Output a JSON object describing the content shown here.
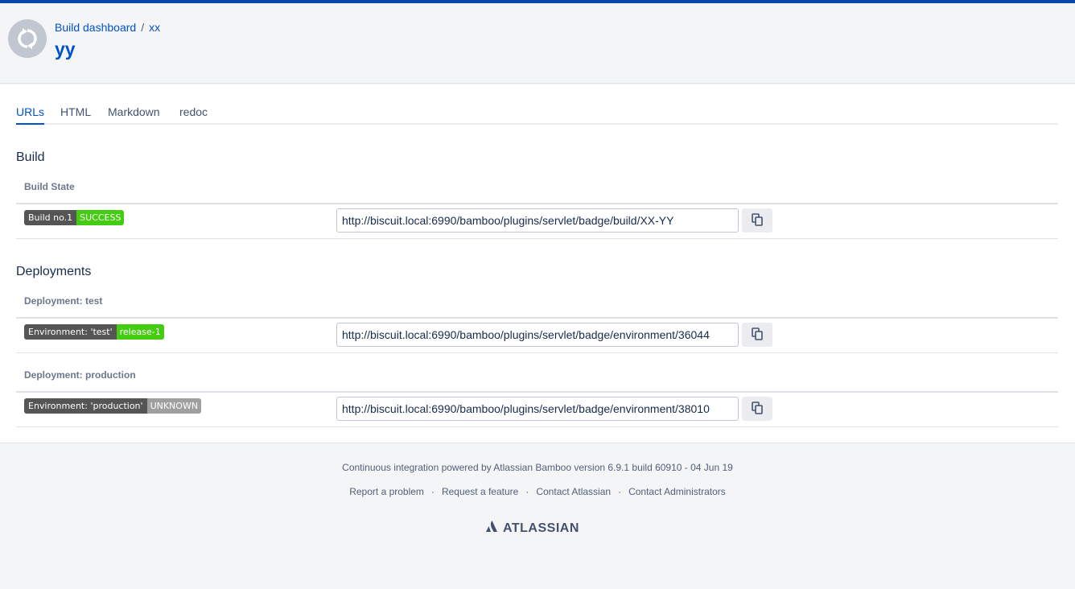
{
  "header": {
    "breadcrumb": [
      "Build dashboard",
      "xx"
    ],
    "breadcrumb_separator": "/",
    "title": "yy",
    "avatar_icon": "refresh-icon"
  },
  "tabs": [
    {
      "label": "URLs",
      "active": true
    },
    {
      "label": "HTML",
      "active": false
    },
    {
      "label": "Markdown",
      "active": false
    },
    {
      "label": "redoc",
      "active": false
    }
  ],
  "build_section": {
    "title": "Build",
    "subheading": "Build State",
    "badge": {
      "label": "Build no.1",
      "value": "SUCCESS",
      "color": "#4c1"
    },
    "url": "http://biscuit.local:6990/bamboo/plugins/servlet/badge/build/XX-YY"
  },
  "deployments_section": {
    "title": "Deployments",
    "items": [
      {
        "subheading": "Deployment: test",
        "badge": {
          "label": "Environment: 'test'",
          "value": "release-1",
          "color": "#4c1"
        },
        "url": "http://biscuit.local:6990/bamboo/plugins/servlet/badge/environment/36044"
      },
      {
        "subheading": "Deployment: production",
        "badge": {
          "label": "Environment: 'production'",
          "value": "UNKNOWN",
          "color": "#9f9f9f"
        },
        "url": "http://biscuit.local:6990/bamboo/plugins/servlet/badge/environment/38010"
      }
    ]
  },
  "footer": {
    "powered_by": "Continuous integration powered by Atlassian Bamboo version 6.9.1 build 60910 - 04 Jun 19",
    "links": [
      "Report a problem",
      "Request a feature",
      "Contact Atlassian",
      "Contact Administrators"
    ],
    "link_separator": "·",
    "logo_text": "ATLASSIAN"
  },
  "colors": {
    "accent": "#0052cc",
    "topbar": "#0747a6",
    "success": "#4c1",
    "unknown": "#9f9f9f"
  }
}
